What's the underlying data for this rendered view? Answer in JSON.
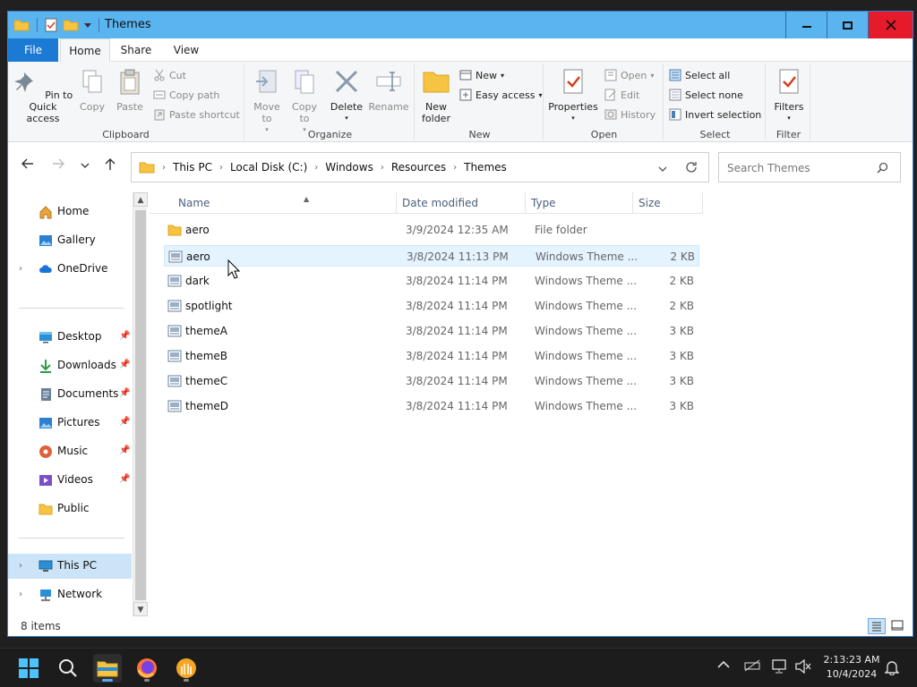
{
  "window": {
    "title": "Themes"
  },
  "ribbon": {
    "tabs": [
      "File",
      "Home",
      "Share",
      "View"
    ],
    "clipboard": {
      "label": "Clipboard",
      "pin": "Pin to Quick access",
      "copy": "Copy",
      "paste": "Paste",
      "cut": "Cut",
      "copy_path": "Copy path",
      "paste_shortcut": "Paste shortcut"
    },
    "organize": {
      "label": "Organize",
      "move_to": "Move to",
      "copy_to": "Copy to",
      "delete": "Delete",
      "rename": "Rename"
    },
    "new": {
      "label": "New",
      "new_folder": "New folder",
      "new_item": "New",
      "easy_access": "Easy access"
    },
    "open": {
      "label": "Open",
      "properties": "Properties",
      "open": "Open",
      "edit": "Edit",
      "history": "History"
    },
    "select": {
      "label": "Select",
      "select_all": "Select all",
      "select_none": "Select none",
      "invert": "Invert selection"
    },
    "filter": {
      "label": "Filter",
      "filters": "Filters"
    }
  },
  "address": {
    "crumbs": [
      "This PC",
      "Local Disk (C:)",
      "Windows",
      "Resources",
      "Themes"
    ],
    "search_placeholder": "Search Themes"
  },
  "nav": {
    "items": [
      {
        "label": "Home"
      },
      {
        "label": "Gallery"
      },
      {
        "label": "OneDrive"
      },
      {
        "label": "Desktop"
      },
      {
        "label": "Downloads"
      },
      {
        "label": "Documents"
      },
      {
        "label": "Pictures"
      },
      {
        "label": "Music"
      },
      {
        "label": "Videos"
      },
      {
        "label": "Public"
      },
      {
        "label": "This PC"
      },
      {
        "label": "Network"
      }
    ]
  },
  "columns": {
    "name": "Name",
    "date": "Date modified",
    "type": "Type",
    "size": "Size"
  },
  "files": [
    {
      "name": "aero",
      "date": "3/9/2024 12:35 AM",
      "type": "File folder",
      "size": ""
    },
    {
      "name": "aero",
      "date": "3/8/2024 11:13 PM",
      "type": "Windows Theme ...",
      "size": "2 KB"
    },
    {
      "name": "dark",
      "date": "3/8/2024 11:14 PM",
      "type": "Windows Theme ...",
      "size": "2 KB"
    },
    {
      "name": "spotlight",
      "date": "3/8/2024 11:14 PM",
      "type": "Windows Theme ...",
      "size": "2 KB"
    },
    {
      "name": "themeA",
      "date": "3/8/2024 11:14 PM",
      "type": "Windows Theme ...",
      "size": "3 KB"
    },
    {
      "name": "themeB",
      "date": "3/8/2024 11:14 PM",
      "type": "Windows Theme ...",
      "size": "3 KB"
    },
    {
      "name": "themeC",
      "date": "3/8/2024 11:14 PM",
      "type": "Windows Theme ...",
      "size": "3 KB"
    },
    {
      "name": "themeD",
      "date": "3/8/2024 11:14 PM",
      "type": "Windows Theme ...",
      "size": "3 KB"
    }
  ],
  "status": {
    "count": "8 items"
  },
  "taskbar": {
    "time": "2:13:23 AM",
    "date": "10/4/2024"
  },
  "colors": {
    "titlebar": "#5ab4ef",
    "file_tab": "#1a7ad4",
    "close": "#e51a2a",
    "selection": "#cce4f7"
  }
}
